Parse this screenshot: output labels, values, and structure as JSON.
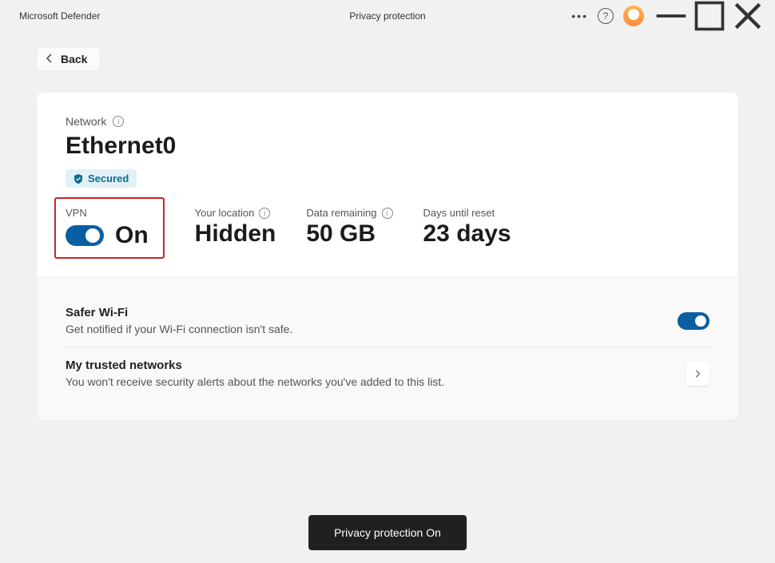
{
  "titlebar": {
    "app_name": "Microsoft Defender",
    "page_title": "Privacy protection"
  },
  "back": {
    "label": "Back"
  },
  "network": {
    "section_label": "Network",
    "name": "Ethernet0",
    "badge_label": "Secured"
  },
  "stats": {
    "vpn": {
      "label": "VPN",
      "state": "On",
      "enabled": true
    },
    "location": {
      "label": "Your location",
      "value": "Hidden"
    },
    "data": {
      "label": "Data remaining",
      "value": "50 GB"
    },
    "reset": {
      "label": "Days until reset",
      "value": "23 days"
    }
  },
  "settings": {
    "safer_wifi": {
      "title": "Safer Wi-Fi",
      "desc": "Get notified if your Wi-Fi connection isn't safe.",
      "enabled": true
    },
    "trusted": {
      "title": "My trusted networks",
      "desc": "You won't receive security alerts about the networks you've added to this list."
    }
  },
  "toast": {
    "message": "Privacy protection On"
  }
}
